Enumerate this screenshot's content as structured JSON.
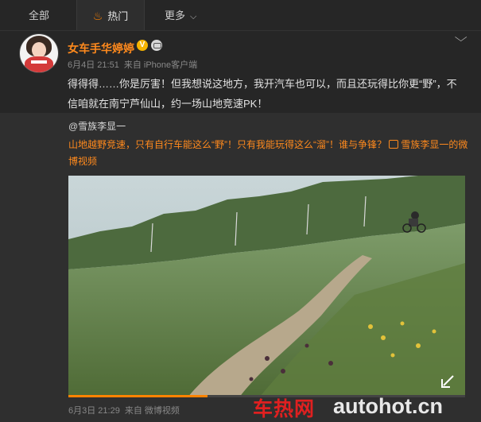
{
  "tabs": {
    "all": "全部",
    "hot": "热门",
    "more": "更多"
  },
  "post": {
    "username": "女车手华婷婷",
    "verified_badge": "V",
    "time": "6月4日 21:51",
    "source": "来自 iPhone客户端",
    "text": "得得得……你是厉害！但我想说这地方，我开汽车也可以，而且还玩得比你更“野”，不信咱就在南宁芦仙山，约一场山地竞速PK！"
  },
  "repost": {
    "user": "@雪族李显一",
    "text": "山地越野竞速，只有自行车能这么“野”！只有我能玩得这么“溜”！谁与争锋？",
    "video_link": "雪族李显一的微博视频",
    "time": "6月3日 21:29",
    "source": "来自 微博视频",
    "video_progress": 0.35
  },
  "watermark": {
    "cn": "车热网",
    "en": "autohot.cn"
  },
  "colors": {
    "accent": "#ff8a1d",
    "watermark_red": "#e02020"
  },
  "icons": {
    "hot": "flame-icon",
    "more": "chevron-down-icon",
    "fold": "chevron-down-icon"
  }
}
